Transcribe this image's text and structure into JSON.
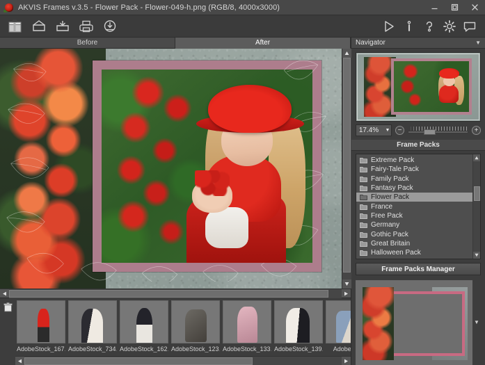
{
  "window": {
    "title": "AKVIS Frames v.3.5 - Flower Pack - Flower-049-h.png (RGB/8, 4000x3000)",
    "app_icon": "rose-icon",
    "minimize_label": "–",
    "maximize_label": "□",
    "close_label": "✕"
  },
  "toolbar": {
    "left_tools": [
      {
        "name": "frame-pack-icon",
        "tooltip": "Frame Pack"
      },
      {
        "name": "open-image-icon",
        "tooltip": "Open Image"
      },
      {
        "name": "save-image-icon",
        "tooltip": "Save Image"
      },
      {
        "name": "print-image-icon",
        "tooltip": "Print Image"
      },
      {
        "name": "import-frames-icon",
        "tooltip": "Import Frames"
      }
    ],
    "right_tools": [
      {
        "name": "run-icon",
        "tooltip": "Run"
      },
      {
        "name": "info-icon",
        "tooltip": "Info"
      },
      {
        "name": "help-icon",
        "tooltip": "Help"
      },
      {
        "name": "settings-icon",
        "tooltip": "Preferences"
      },
      {
        "name": "comment-icon",
        "tooltip": "Comments"
      }
    ]
  },
  "tabs": [
    {
      "label": "Before",
      "active": false
    },
    {
      "label": "After",
      "active": true
    }
  ],
  "navigator": {
    "title": "Navigator",
    "zoom_value": "17.4%",
    "zoom_out_label": "−",
    "zoom_in_label": "+",
    "dropdown_caret": "▼",
    "collapse_caret": "▼"
  },
  "frame_packs": {
    "title": "Frame Packs",
    "items": [
      {
        "label": "Extreme Pack",
        "selected": false
      },
      {
        "label": "Fairy-Tale Pack",
        "selected": false
      },
      {
        "label": "Family Pack",
        "selected": false
      },
      {
        "label": "Fantasy Pack",
        "selected": false
      },
      {
        "label": "Flower Pack",
        "selected": true
      },
      {
        "label": "France",
        "selected": false
      },
      {
        "label": "Free Pack",
        "selected": false
      },
      {
        "label": "Germany",
        "selected": false
      },
      {
        "label": "Gothic Pack",
        "selected": false
      },
      {
        "label": "Great Britain",
        "selected": false
      },
      {
        "label": "Halloween Pack",
        "selected": false
      }
    ],
    "manager_button": "Frame Packs Manager"
  },
  "frame_preview": {
    "expand_caret": "▼"
  },
  "filmstrip": {
    "delete_icon": "trash-icon",
    "scroll_left": "◀",
    "scroll_right": "▶",
    "thumbnails": [
      {
        "caption": "AdobeStock_167…"
      },
      {
        "caption": "AdobeStock_734…"
      },
      {
        "caption": "AdobeStock_162…"
      },
      {
        "caption": "AdobeStock_123…"
      },
      {
        "caption": "AdobeStock_133…"
      },
      {
        "caption": "AdobeStock_139…"
      },
      {
        "caption": "AdobeSto…"
      }
    ]
  },
  "canvas": {
    "scroll_up": "▲",
    "scroll_down": "▼",
    "scroll_left": "◀",
    "scroll_right": "▶"
  },
  "colors": {
    "titlebar": "#484848",
    "toolbar": "#3b3b3b",
    "panel": "#3d3d3d",
    "selection": "#9b9b9b",
    "accent_red": "#c21d12",
    "text": "#d6d6d6"
  }
}
